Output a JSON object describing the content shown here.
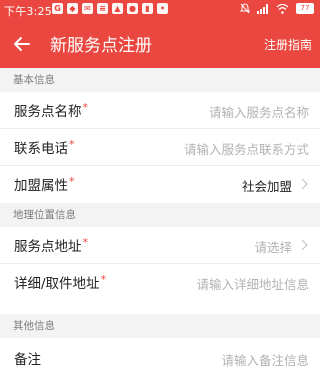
{
  "status": {
    "time": "下午3:25",
    "battery": "77"
  },
  "header": {
    "title": "新服务点注册",
    "guide": "注册指南"
  },
  "sections": {
    "basic": "基本信息",
    "location": "地理位置信息",
    "other": "其他信息"
  },
  "fields": {
    "name": {
      "label": "服务点名称",
      "required": "*",
      "placeholder": "请输入服务点名称"
    },
    "phone": {
      "label": "联系电话",
      "required": "*",
      "placeholder": "请输入服务点联系方式"
    },
    "type": {
      "label": "加盟属性",
      "required": "*",
      "value": "社会加盟"
    },
    "address": {
      "label": "服务点地址",
      "required": "*",
      "placeholder": "请选择"
    },
    "detail": {
      "label": "详细/取件地址",
      "required": "*",
      "placeholder": "请输入详细地址信息"
    },
    "remark": {
      "label": "备注",
      "placeholder": "请输入备注信息"
    }
  },
  "colors": {
    "primary": "#e9473f",
    "section_bg": "#f3f3f3"
  }
}
